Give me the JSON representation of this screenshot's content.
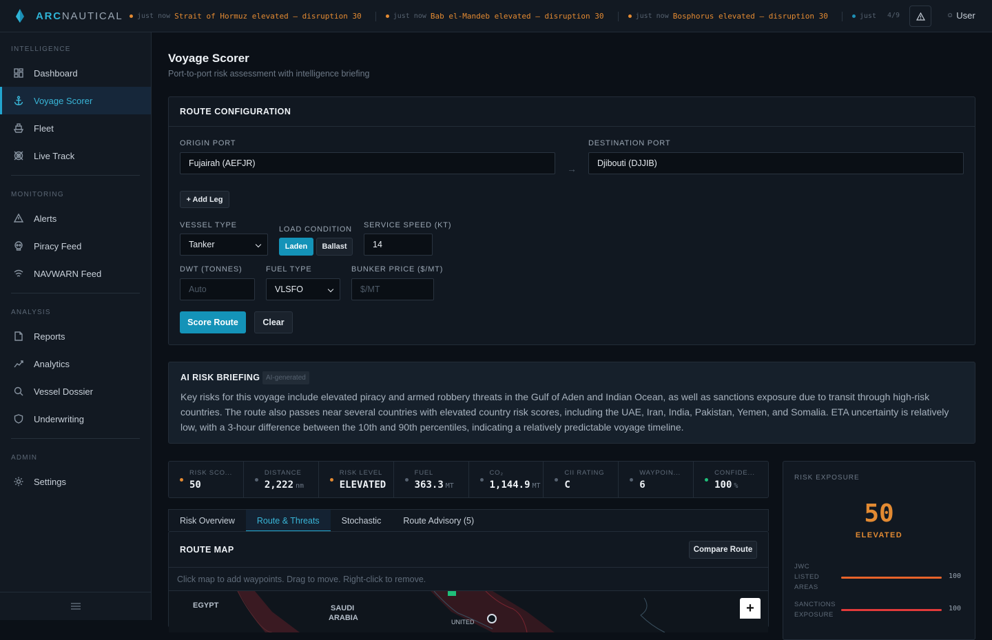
{
  "brand": {
    "name_a": "ARC",
    "name_b": "NAUTICAL"
  },
  "ticker": [
    {
      "time": "just now",
      "msg": "Strait of Hormuz elevated — disruption 30",
      "dot": "#e38a32"
    },
    {
      "time": "just now",
      "msg": "Bab el-Mandeb elevated — disruption 30",
      "dot": "#e38a32"
    },
    {
      "time": "just now",
      "msg": "Bosphorus elevated — disruption 30",
      "dot": "#e38a32"
    },
    {
      "time": "just n",
      "msg": "",
      "dot": "#1e8fb5"
    }
  ],
  "ticker_pager": "4/9",
  "user": "User",
  "sidebar": {
    "sections": [
      {
        "title": "INTELLIGENCE",
        "items": [
          {
            "label": "Dashboard",
            "icon": "dashboard-icon"
          },
          {
            "label": "Voyage Scorer",
            "icon": "anchor-icon",
            "active": true
          },
          {
            "label": "Fleet",
            "icon": "ship-icon"
          },
          {
            "label": "Live Track",
            "icon": "radar-icon"
          }
        ]
      },
      {
        "title": "MONITORING",
        "items": [
          {
            "label": "Alerts",
            "icon": "warning-icon"
          },
          {
            "label": "Piracy Feed",
            "icon": "skull-icon"
          },
          {
            "label": "NAVWARN Feed",
            "icon": "signal-icon"
          }
        ]
      },
      {
        "title": "ANALYSIS",
        "items": [
          {
            "label": "Reports",
            "icon": "document-icon"
          },
          {
            "label": "Analytics",
            "icon": "trend-icon"
          },
          {
            "label": "Vessel Dossier",
            "icon": "search-icon"
          },
          {
            "label": "Underwriting",
            "icon": "shield-icon"
          }
        ]
      },
      {
        "title": "ADMIN",
        "items": [
          {
            "label": "Settings",
            "icon": "gear-icon"
          }
        ]
      }
    ]
  },
  "page": {
    "title": "Voyage Scorer",
    "subtitle": "Port-to-port risk assessment with intelligence briefing"
  },
  "route": {
    "header": "ROUTE CONFIGURATION",
    "origin_label": "ORIGIN PORT",
    "origin_value": "Fujairah (AEFJR)",
    "dest_label": "DESTINATION PORT",
    "dest_value": "Djibouti (DJJIB)",
    "add_leg": "+ Add Leg",
    "vessel_type_label": "VESSEL TYPE",
    "vessel_type_value": "Tanker",
    "load_label": "LOAD CONDITION",
    "load_laden": "Laden",
    "load_ballast": "Ballast",
    "speed_label": "SERVICE SPEED (KT)",
    "speed_value": "14",
    "dwt_label": "DWT (TONNES)",
    "dwt_placeholder": "Auto",
    "fuel_label": "FUEL TYPE",
    "fuel_value": "VLSFO",
    "bunker_label": "BUNKER PRICE ($/MT)",
    "bunker_placeholder": "$/MT",
    "score_btn": "Score Route",
    "clear_btn": "Clear"
  },
  "briefing": {
    "title": "AI RISK BRIEFING",
    "badge": "AI-generated",
    "text": "Key risks for this voyage include elevated piracy and armed robbery threats in the Gulf of Aden and Indian Ocean, as well as sanctions exposure due to transit through high-risk countries. The route also passes near several countries with elevated country risk scores, including the UAE, Iran, India, Pakistan, Yemen, and Somalia. ETA uncertainty is relatively low, with a 3-hour difference between the 10th and 90th percentiles, indicating a relatively predictable voyage timeline."
  },
  "stats": [
    {
      "label": "RISK SCO...",
      "value": "50",
      "unit": "",
      "dot": "#e38a32"
    },
    {
      "label": "DISTANCE",
      "value": "2,222",
      "unit": "nm",
      "dot": "#566270"
    },
    {
      "label": "RISK LEVEL",
      "value": "ELEVATED",
      "unit": "",
      "dot": "#e38a32"
    },
    {
      "label": "FUEL",
      "value": "363.3",
      "unit": "MT",
      "dot": "#566270"
    },
    {
      "label": "CO₂",
      "value": "1,144.9",
      "unit": "MT",
      "dot": "#566270"
    },
    {
      "label": "CII RATING",
      "value": "C",
      "unit": "",
      "dot": "#566270"
    },
    {
      "label": "WAYPOIN...",
      "value": "6",
      "unit": "",
      "dot": "#566270"
    },
    {
      "label": "CONFIDE...",
      "value": "100",
      "unit": "%",
      "dot": "#1fbf7a"
    }
  ],
  "tabs": [
    {
      "label": "Risk Overview"
    },
    {
      "label": "Route & Threats",
      "active": true
    },
    {
      "label": "Stochastic"
    },
    {
      "label": "Route Advisory (5)"
    }
  ],
  "map": {
    "header": "ROUTE MAP",
    "compare": "Compare Route",
    "hint": "Click map to add waypoints. Drag to move. Right-click to remove.",
    "labels": {
      "egypt": "EGYPT",
      "saudi_1": "SAUDI",
      "saudi_2": "ARABIA",
      "uae": "UNITED"
    },
    "zoom_in": "+"
  },
  "exposure": {
    "title": "RISK EXPOSURE",
    "score": "50",
    "level": "ELEVATED",
    "bars": [
      {
        "label_lines": [
          "JWC",
          "LISTED",
          "AREAS"
        ],
        "value": "100",
        "fraction": 1.0,
        "color": "#e8632a"
      },
      {
        "label_lines": [
          "SANCTIONS",
          "EXPOSURE"
        ],
        "value": "100",
        "fraction": 1.0,
        "color": "#e23a3a"
      }
    ]
  },
  "colors": {
    "accent": "#1493b8",
    "warning": "#e38a32",
    "danger": "#e23a3a",
    "ok": "#1fbf7a"
  }
}
